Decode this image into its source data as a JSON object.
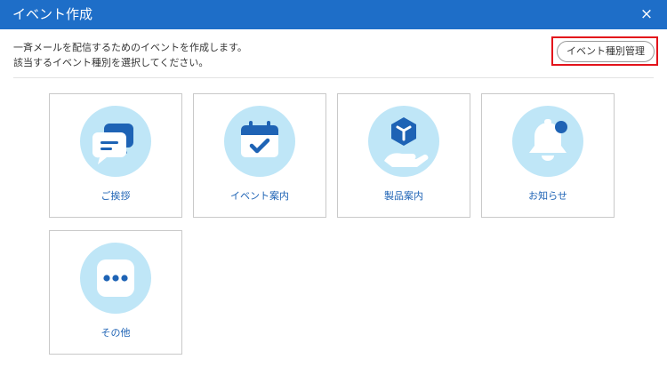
{
  "dialog": {
    "title": "イベント作成",
    "close_icon": "×"
  },
  "description": {
    "line1": "一斉メールを配信するためのイベントを作成します。",
    "line2": "該当するイベント種別を選択してください。"
  },
  "manage_button": {
    "label": "イベント種別管理"
  },
  "event_types": [
    {
      "label": "ご挨拶",
      "icon": "speech-bubbles-icon"
    },
    {
      "label": "イベント案内",
      "icon": "calendar-check-icon"
    },
    {
      "label": "製品案内",
      "icon": "product-box-hand-icon"
    },
    {
      "label": "お知らせ",
      "icon": "bell-icon"
    },
    {
      "label": "その他",
      "icon": "more-dots-icon"
    }
  ],
  "colors": {
    "header": "#1e6ec8",
    "accent_blue": "#1e63b5",
    "icon_bg": "#bfe6f7",
    "highlight": "#e3131b"
  }
}
